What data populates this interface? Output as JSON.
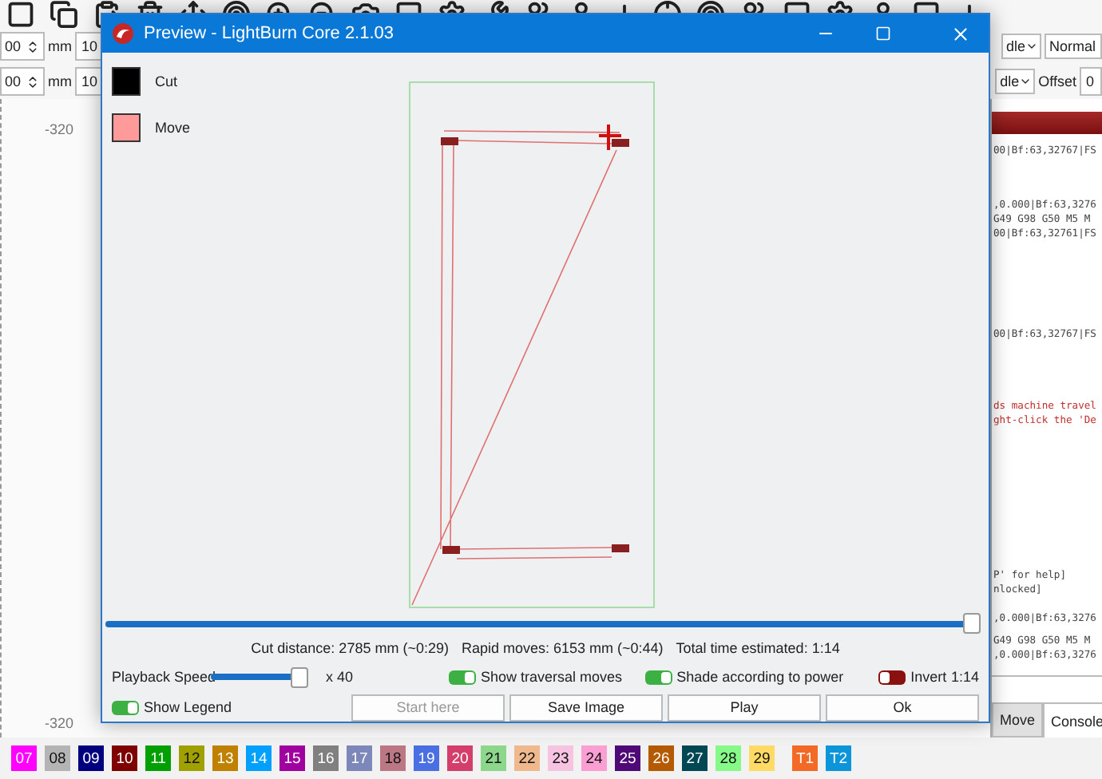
{
  "options": [
    {
      "value": "00",
      "unit": "mm",
      "value_2": "10",
      "dropdown": "dle",
      "dropdown_2": "Normal"
    },
    {
      "value": "00",
      "unit": "mm",
      "value_2": "10",
      "dropdown": "dle",
      "label": "Offset",
      "field": "0"
    }
  ],
  "canvas": {
    "ruler_labels": [
      "-320",
      "-320"
    ]
  },
  "console": {
    "lines": [
      {
        "text": "00|Bf:63,32767|FS",
        "kind": "normal"
      },
      {
        "text": ",0.000|Bf:63,3276",
        "kind": "normal"
      },
      {
        "text": " G49 G98 G50 M5 M",
        "kind": "normal"
      },
      {
        "text": "00|Bf:63,32761|FS",
        "kind": "normal"
      },
      {
        "text": "00|Bf:63,32767|FS",
        "kind": "normal"
      },
      {
        "text": "ds machine travel",
        "kind": "error"
      },
      {
        "text": "ght-click the 'De",
        "kind": "error"
      },
      {
        "text": "P' for help]",
        "kind": "normal"
      },
      {
        "text": "nlocked]",
        "kind": "normal"
      },
      {
        "text": ",0.000|Bf:63,3276",
        "kind": "normal"
      },
      {
        "text": "G49 G98 G50 M5 M",
        "kind": "normal"
      },
      {
        "text": ",0.000|Bf:63,3276",
        "kind": "normal"
      }
    ]
  },
  "panel_tabs": [
    {
      "label": "Move",
      "selected": false
    },
    {
      "label": "Console",
      "selected": true
    }
  ],
  "palette": [
    {
      "label": "07",
      "color": "#ff00ff"
    },
    {
      "label": "08",
      "color": "#b4b4b4"
    },
    {
      "label": "09",
      "color": "#00007f"
    },
    {
      "label": "10",
      "color": "#7f0000"
    },
    {
      "label": "11",
      "color": "#00a000"
    },
    {
      "label": "12",
      "color": "#a0a000"
    },
    {
      "label": "13",
      "color": "#c08000"
    },
    {
      "label": "14",
      "color": "#00a0ff"
    },
    {
      "label": "15",
      "color": "#a000a0"
    },
    {
      "label": "16",
      "color": "#808080"
    },
    {
      "label": "17",
      "color": "#7d87b9"
    },
    {
      "label": "18",
      "color": "#bb7784"
    },
    {
      "label": "19",
      "color": "#4a6fe3"
    },
    {
      "label": "20",
      "color": "#d33f6a"
    },
    {
      "label": "21",
      "color": "#8cd78c"
    },
    {
      "label": "22",
      "color": "#f0b98d"
    },
    {
      "label": "23",
      "color": "#f6c4e1"
    },
    {
      "label": "24",
      "color": "#fa9ed4"
    },
    {
      "label": "25",
      "color": "#500a78"
    },
    {
      "label": "26",
      "color": "#b45a00"
    },
    {
      "label": "27",
      "color": "#004754"
    },
    {
      "label": "28",
      "color": "#86fa88"
    },
    {
      "label": "29",
      "color": "#ffdb66"
    },
    {
      "label": "T1",
      "color": "#f36926"
    },
    {
      "label": "T2",
      "color": "#0c96d9"
    }
  ],
  "dialog": {
    "title": "Preview - LightBurn Core 2.1.03",
    "legend": [
      {
        "label": "Cut",
        "color": "#000000"
      },
      {
        "label": "Move",
        "color": "#ff9a9a"
      }
    ],
    "progress": {
      "level": 1.0
    },
    "stats": [
      "Cut distance: 2785 mm (~0:29)",
      "Rapid moves: 6153 mm (~0:44)",
      "Total time estimated: 1:14"
    ],
    "speed": {
      "label": "Playback Speed",
      "level": 0.92,
      "reading": "x 40"
    },
    "toggles": [
      {
        "label": "Show traversal moves",
        "on": true
      },
      {
        "label": "Shade according to power",
        "on": true
      },
      {
        "label": "Invert",
        "on": false
      }
    ],
    "time": "1:14",
    "legend_toggle": {
      "label": "Show Legend",
      "on": true
    },
    "buttons": [
      {
        "label": "Start here",
        "disabled": true
      },
      {
        "label": "Save Image",
        "disabled": false
      },
      {
        "label": "Play",
        "disabled": false
      },
      {
        "label": "Ok",
        "disabled": false
      }
    ]
  }
}
